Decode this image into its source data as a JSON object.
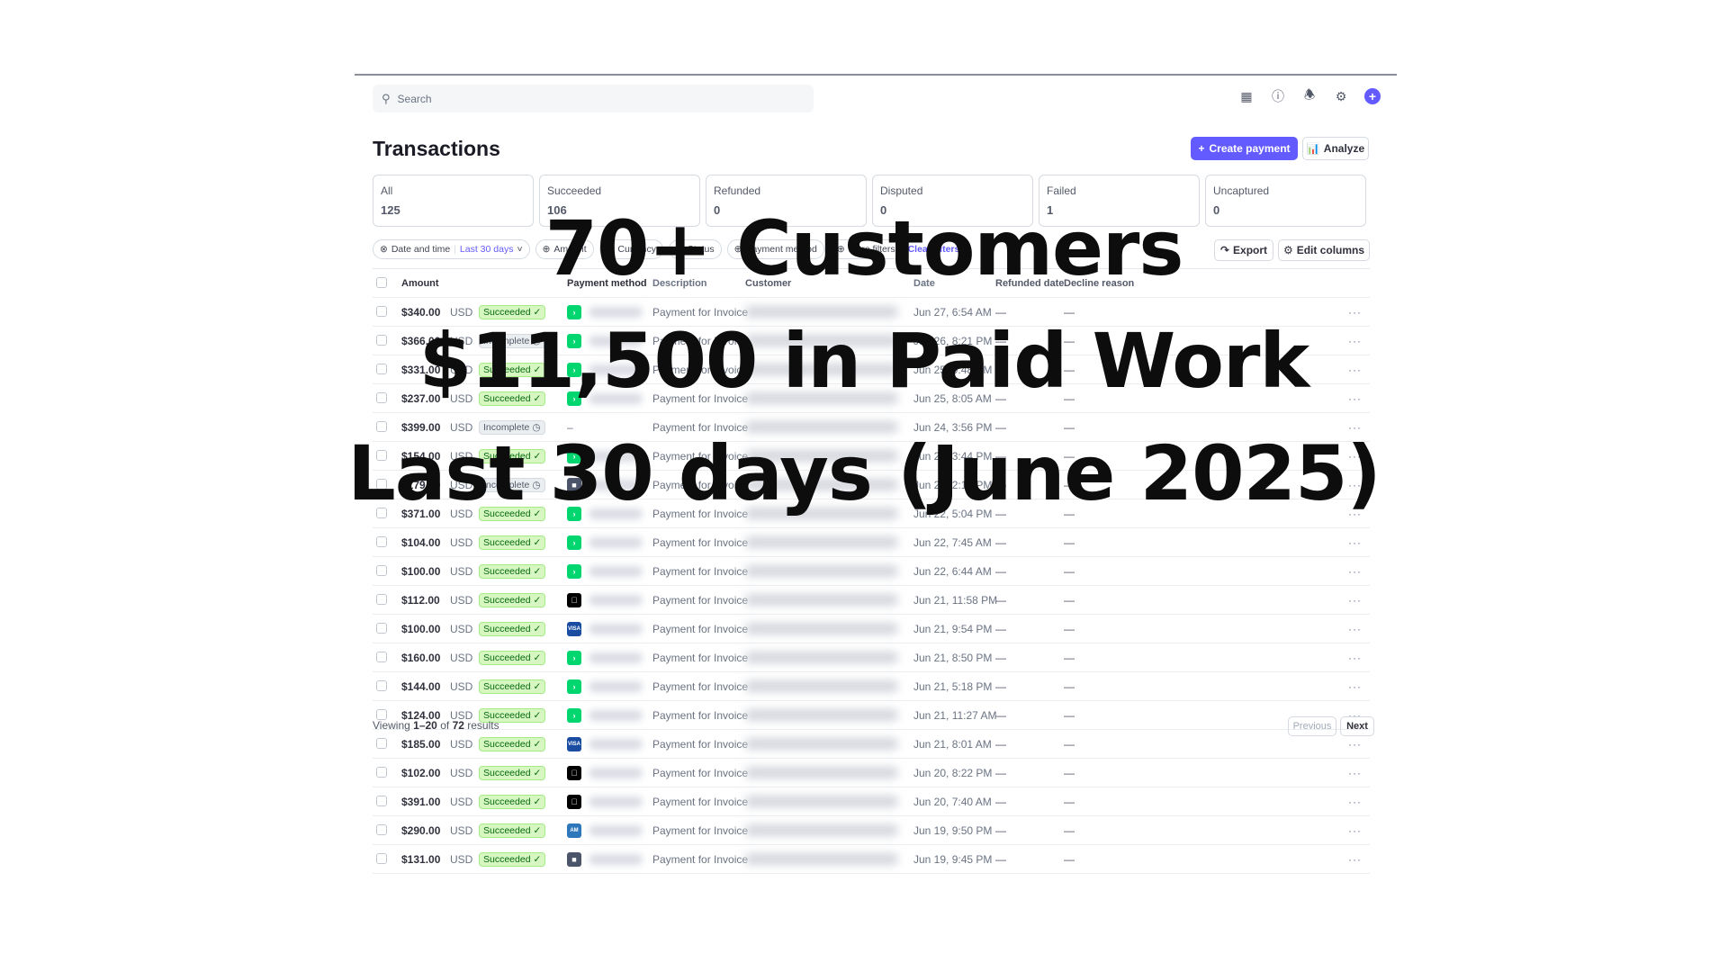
{
  "search": {
    "placeholder": "Search"
  },
  "page": {
    "title": "Transactions",
    "create_label": "Create payment",
    "analyze_label": "Analyze",
    "export_label": "Export",
    "edit_columns_label": "Edit columns"
  },
  "cards": [
    {
      "label": "All",
      "value": "125"
    },
    {
      "label": "Succeeded",
      "value": "106"
    },
    {
      "label": "Refunded",
      "value": "0"
    },
    {
      "label": "Disputed",
      "value": "0"
    },
    {
      "label": "Failed",
      "value": "1"
    },
    {
      "label": "Uncaptured",
      "value": "0"
    }
  ],
  "filters": {
    "date_label": "Date and time",
    "date_value": "Last 30 days",
    "amount": "Amount",
    "currency": "Currency",
    "status": "Status",
    "payment_method": "Payment method",
    "more": "More filters",
    "clear": "Clear filters"
  },
  "columns": {
    "amount": "Amount",
    "payment_method": "Payment method",
    "description": "Description",
    "customer": "Customer",
    "date": "Date",
    "refunded_date": "Refunded date",
    "decline_reason": "Decline reason"
  },
  "rows": [
    {
      "amount": "$340.00",
      "currency": "USD",
      "status": "Succeeded",
      "pm": "link",
      "description": "Payment for Invoice",
      "date": "Jun 27, 6:54 AM",
      "refunded": "—",
      "decline": "—"
    },
    {
      "amount": "$366.00",
      "currency": "USD",
      "status": "Incomplete",
      "pm": "link",
      "description": "Payment for Invoice",
      "date": "Jun 26, 8:21 PM",
      "refunded": "—",
      "decline": "—"
    },
    {
      "amount": "$331.00",
      "currency": "USD",
      "status": "Succeeded",
      "pm": "link",
      "description": "Payment for Invoice",
      "date": "Jun 25, 9:48 PM",
      "refunded": "—",
      "decline": "—"
    },
    {
      "amount": "$237.00",
      "currency": "USD",
      "status": "Succeeded",
      "pm": "link",
      "description": "Payment for Invoice",
      "date": "Jun 25, 8:05 AM",
      "refunded": "—",
      "decline": "—"
    },
    {
      "amount": "$399.00",
      "currency": "USD",
      "status": "Incomplete",
      "pm": "none",
      "description": "Payment for Invoice",
      "date": "Jun 24, 3:56 PM",
      "refunded": "—",
      "decline": "—"
    },
    {
      "amount": "$154.00",
      "currency": "USD",
      "status": "Succeeded",
      "pm": "link",
      "description": "Payment for Invoice",
      "date": "Jun 24, 3:44 PM",
      "refunded": "—",
      "decline": "—"
    },
    {
      "amount": "$179.00",
      "currency": "USD",
      "status": "Incomplete",
      "pm": "card",
      "description": "Payment for Invoice",
      "date": "Jun 23, 2:10 PM",
      "refunded": "—",
      "decline": "—"
    },
    {
      "amount": "$371.00",
      "currency": "USD",
      "status": "Succeeded",
      "pm": "link",
      "description": "Payment for Invoice",
      "date": "Jun 22, 5:04 PM",
      "refunded": "—",
      "decline": "—"
    },
    {
      "amount": "$104.00",
      "currency": "USD",
      "status": "Succeeded",
      "pm": "link",
      "description": "Payment for Invoice",
      "date": "Jun 22, 7:45 AM",
      "refunded": "—",
      "decline": "—"
    },
    {
      "amount": "$100.00",
      "currency": "USD",
      "status": "Succeeded",
      "pm": "link",
      "description": "Payment for Invoice",
      "date": "Jun 22, 6:44 AM",
      "refunded": "—",
      "decline": "—"
    },
    {
      "amount": "$112.00",
      "currency": "USD",
      "status": "Succeeded",
      "pm": "apple",
      "description": "Payment for Invoice",
      "date": "Jun 21, 11:58 PM",
      "refunded": "—",
      "decline": "—"
    },
    {
      "amount": "$100.00",
      "currency": "USD",
      "status": "Succeeded",
      "pm": "visa",
      "description": "Payment for Invoice",
      "date": "Jun 21, 9:54 PM",
      "refunded": "—",
      "decline": "—"
    },
    {
      "amount": "$160.00",
      "currency": "USD",
      "status": "Succeeded",
      "pm": "link",
      "description": "Payment for Invoice",
      "date": "Jun 21, 8:50 PM",
      "refunded": "—",
      "decline": "—"
    },
    {
      "amount": "$144.00",
      "currency": "USD",
      "status": "Succeeded",
      "pm": "link",
      "description": "Payment for Invoice",
      "date": "Jun 21, 5:18 PM",
      "refunded": "—",
      "decline": "—"
    },
    {
      "amount": "$124.00",
      "currency": "USD",
      "status": "Succeeded",
      "pm": "link",
      "description": "Payment for Invoice",
      "date": "Jun 21, 11:27 AM",
      "refunded": "—",
      "decline": "—"
    },
    {
      "amount": "$185.00",
      "currency": "USD",
      "status": "Succeeded",
      "pm": "visa",
      "description": "Payment for Invoice",
      "date": "Jun 21, 8:01 AM",
      "refunded": "—",
      "decline": "—"
    },
    {
      "amount": "$102.00",
      "currency": "USD",
      "status": "Succeeded",
      "pm": "apple",
      "description": "Payment for Invoice",
      "date": "Jun 20, 8:22 PM",
      "refunded": "—",
      "decline": "—"
    },
    {
      "amount": "$391.00",
      "currency": "USD",
      "status": "Succeeded",
      "pm": "apple",
      "description": "Payment for Invoice",
      "date": "Jun 20, 7:40 AM",
      "refunded": "—",
      "decline": "—"
    },
    {
      "amount": "$290.00",
      "currency": "USD",
      "status": "Succeeded",
      "pm": "amex",
      "description": "Payment for Invoice",
      "date": "Jun 19, 9:50 PM",
      "refunded": "—",
      "decline": "—"
    },
    {
      "amount": "$131.00",
      "currency": "USD",
      "status": "Succeeded",
      "pm": "card",
      "description": "Payment for Invoice",
      "date": "Jun 19, 9:45 PM",
      "refunded": "—",
      "decline": "—"
    }
  ],
  "footer": {
    "viewing_prefix": "Viewing",
    "range": "1–20",
    "of": "of",
    "total": "72",
    "suffix": "results",
    "previous": "Previous",
    "next": "Next"
  },
  "overlay": {
    "line1": "70+ Customers",
    "line2": "$11,500 in Paid Work",
    "line3": "Last 30 days (June 2025)"
  },
  "colors": {
    "accent": "#635bff",
    "success_bg": "#d7f7c2",
    "success_text": "#05690d",
    "link_green": "#00d66f",
    "visa_blue": "#1a4da1"
  }
}
